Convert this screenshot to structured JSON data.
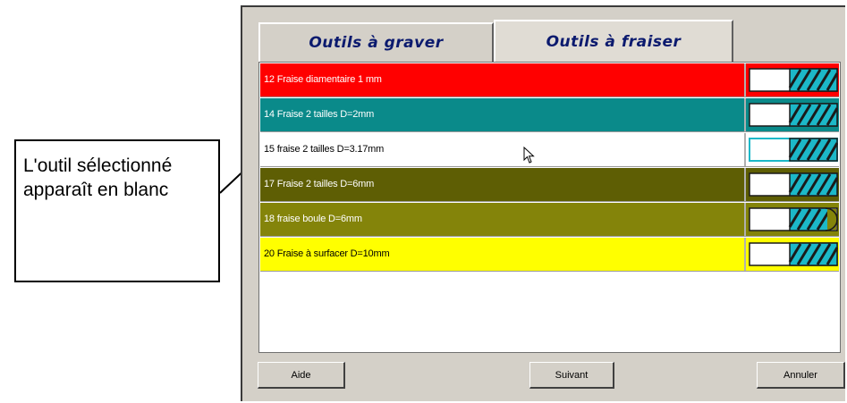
{
  "tabs": [
    {
      "label": "Outils à graver",
      "selected": false
    },
    {
      "label": "Outils à fraiser",
      "selected": true
    }
  ],
  "tools": [
    {
      "label": "12 Fraise diamentaire 1 mm",
      "color": "#ff0000",
      "text_color": "#ffffff",
      "icon": "flat-end-mill-icon"
    },
    {
      "label": "14 Fraise 2 tailles D=2mm",
      "color": "#0a8a8a",
      "text_color": "#ffffff",
      "icon": "flat-end-mill-icon"
    },
    {
      "label": "15 fraise 2 tailles D=3.17mm",
      "color": "#ffffff",
      "text_color": "#000000",
      "icon": "flat-end-mill-icon",
      "selected": true
    },
    {
      "label": "17 Fraise 2 tailles D=6mm",
      "color": "#5e5e04",
      "text_color": "#ffffff",
      "icon": "flat-end-mill-icon"
    },
    {
      "label": "18 fraise boule D=6mm",
      "color": "#84840a",
      "text_color": "#ffffff",
      "icon": "ball-end-mill-icon"
    },
    {
      "label": "20 Fraise à surfacer D=10mm",
      "color": "#ffff00",
      "text_color": "#000000",
      "icon": "flat-end-mill-icon"
    }
  ],
  "buttons": {
    "help": "Aide",
    "next": "Suivant",
    "cancel": "Annuler"
  },
  "callout": {
    "text": "L'outil sélectionné apparaît en blanc"
  },
  "colors": {
    "tab_text": "#0b1a6e",
    "icon_hatch": "#1cb8c8",
    "window_bg": "#d4d0c8"
  }
}
